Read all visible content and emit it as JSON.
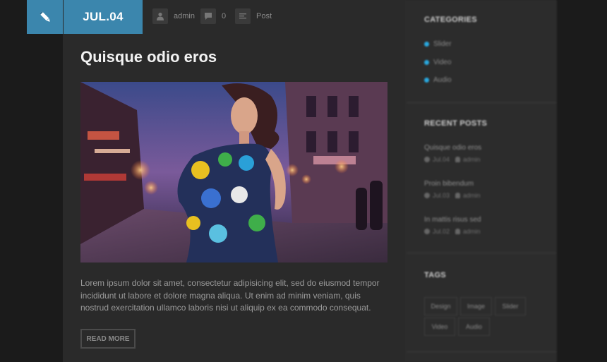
{
  "post": {
    "date": "JUL.04",
    "author": "admin",
    "comments": "0",
    "format": "Post",
    "title": "Quisque odio eros",
    "excerpt": "Lorem ipsum dolor sit amet, consectetur adipisicing elit, sed do eiusmod tempor incididunt ut labore et dolore magna aliqua. Ut enim ad minim veniam, quis nostrud exercitation ullamco laboris nisi ut aliquip ex ea commodo consequat.",
    "read_more": "READ MORE"
  },
  "icons": {
    "edit": "pencil-icon",
    "author": "user-icon",
    "comments": "comment-icon",
    "format": "text-lines-icon"
  },
  "sidebar": {
    "categories": {
      "title": "CATEGORIES",
      "items": [
        "Slider",
        "Video",
        "Audio"
      ]
    },
    "recent_posts": {
      "title": "RECENT POSTS",
      "items": [
        {
          "title": "Quisque odio eros",
          "date": "Jul.04",
          "author": "admin"
        },
        {
          "title": "Proin bibendum",
          "date": "Jul.03",
          "author": "admin"
        },
        {
          "title": "In mattis risus sed",
          "date": "Jul.02",
          "author": "admin"
        }
      ]
    },
    "tags": {
      "title": "TAGS",
      "items": [
        "Design",
        "Image",
        "Slider",
        "Video",
        "Audio"
      ]
    }
  },
  "colors": {
    "accent": "#3b86ad",
    "category_dot": "#29a9e0",
    "background": "#1b1b1b",
    "content": "#2a2a2a"
  }
}
